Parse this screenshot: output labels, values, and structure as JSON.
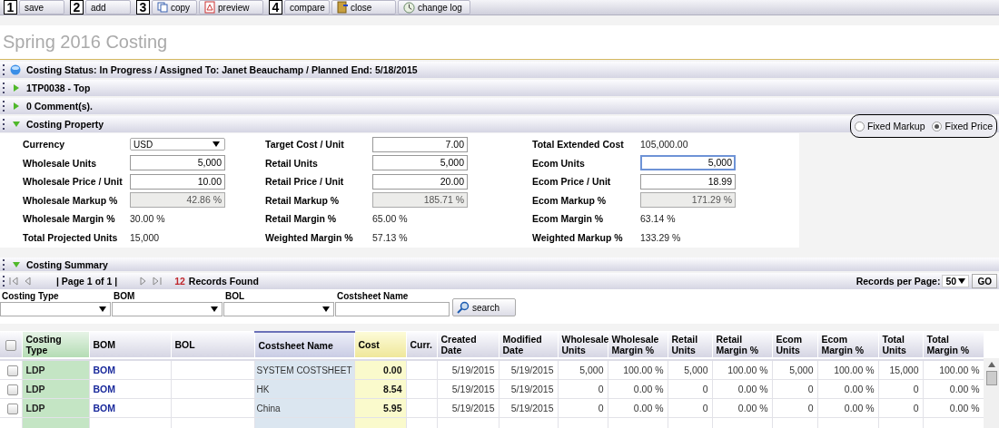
{
  "toolbar": [
    {
      "label": "save",
      "marker": "1"
    },
    {
      "label": "add",
      "marker": "2"
    },
    {
      "label": "copy",
      "marker": "3"
    },
    {
      "label": "preview"
    },
    {
      "label": "compare",
      "marker": "4"
    },
    {
      "label": "close"
    },
    {
      "label": "change log"
    }
  ],
  "title": "Spring 2016 Costing",
  "panels": [
    {
      "kind": "status",
      "title": "Costing  Status: In Progress / Assigned To: Janet Beauchamp / Planned End: 5/18/2015"
    },
    {
      "kind": "toggle",
      "title": "1TP0038 - Top",
      "expanded": false
    },
    {
      "kind": "toggle",
      "title": "0 Comment(s).",
      "expanded": false
    },
    {
      "kind": "toggle",
      "title": "Costing Property",
      "expanded": true
    }
  ],
  "pricing_mode": [
    {
      "label": "Fixed Markup",
      "selected": false
    },
    {
      "label": "Fixed Price",
      "selected": true
    }
  ],
  "form": [
    {
      "label": "Currency",
      "kind": "select",
      "value": "USD"
    },
    {
      "label": "Target Cost / Unit",
      "kind": "input",
      "value": "7.00",
      "focused": false
    },
    {
      "label": "Total Extended Cost",
      "kind": "text",
      "value": "105,000.00"
    },
    {
      "label": "Wholesale Units",
      "kind": "input",
      "value": "5,000",
      "focused": false
    },
    {
      "label": "Retail Units",
      "kind": "input",
      "value": "5,000",
      "focused": false
    },
    {
      "label": "Ecom Units",
      "kind": "input",
      "value": "5,000",
      "focused": true
    },
    {
      "label": "Wholesale Price / Unit",
      "kind": "input",
      "value": "10.00",
      "focused": false
    },
    {
      "label": "Retail Price / Unit",
      "kind": "input",
      "value": "20.00",
      "focused": false
    },
    {
      "label": "Ecom Price / Unit",
      "kind": "input",
      "value": "18.99",
      "focused": false
    },
    {
      "label": "Wholesale Markup %",
      "kind": "readonly",
      "value": "42.86 %"
    },
    {
      "label": "Retail Markup %",
      "kind": "readonly",
      "value": "185.71 %"
    },
    {
      "label": "Ecom Markup %",
      "kind": "readonly",
      "value": "171.29 %"
    },
    {
      "label": "Wholesale Margin %",
      "kind": "text",
      "value": "30.00 %"
    },
    {
      "label": "Retail Margin %",
      "kind": "text",
      "value": "65.00 %"
    },
    {
      "label": "Ecom Margin %",
      "kind": "text",
      "value": "63.14 %"
    },
    {
      "label": "Total Projected Units",
      "kind": "text",
      "value": "15,000"
    },
    {
      "label": "Weighted Margin %",
      "kind": "text",
      "value": "57.13 %"
    },
    {
      "label": "Weighted Markup %",
      "kind": "text",
      "value": "133.29 %"
    }
  ],
  "summary": {
    "title": "Costing Summary",
    "expanded": true,
    "pager": {
      "page": "| Page 1 of 1 |",
      "count": "12",
      "count_label": "Records Found",
      "per_page_label": "Records per Page:",
      "per_page": "50",
      "go": "GO"
    },
    "filters": [
      {
        "label": "Costing Type",
        "kind": "select"
      },
      {
        "label": "BOM",
        "kind": "select"
      },
      {
        "label": "BOL",
        "kind": "select"
      },
      {
        "label": "Costsheet Name",
        "kind": "input"
      }
    ],
    "search_button": "search",
    "table": {
      "select_all": false,
      "columns": [
        {
          "label": "Costing Type",
          "kind": "type"
        },
        {
          "label": "BOM",
          "kind": "link"
        },
        {
          "label": "BOL",
          "kind": "plain"
        },
        {
          "label": "Costsheet Name",
          "kind": "name"
        },
        {
          "label": "Cost",
          "kind": "cost"
        },
        {
          "label": "Curr.",
          "kind": "plain"
        },
        {
          "label": "Created Date",
          "kind": "num"
        },
        {
          "label": "Modified Date",
          "kind": "num"
        },
        {
          "label": "Wholesale Units",
          "kind": "num"
        },
        {
          "label": "Wholesale Margin %",
          "kind": "num"
        },
        {
          "label": "Retail Units",
          "kind": "num"
        },
        {
          "label": "Retail Margin %",
          "kind": "num"
        },
        {
          "label": "Ecom Units",
          "kind": "num"
        },
        {
          "label": "Ecom Margin %",
          "kind": "num"
        },
        {
          "label": "Total Units",
          "kind": "num"
        },
        {
          "label": "Total Margin %",
          "kind": "num"
        }
      ],
      "rows": [
        {
          "checked": false,
          "cells": [
            "LDP",
            "BOM",
            "",
            "SYSTEM COSTSHEET",
            "0.00",
            "",
            "5/19/2015",
            "5/19/2015",
            "5,000",
            "100.00 %",
            "5,000",
            "100.00 %",
            "5,000",
            "100.00 %",
            "15,000",
            "100.00 %"
          ]
        },
        {
          "checked": false,
          "cells": [
            "LDP",
            "BOM",
            "",
            "HK",
            "8.54",
            "",
            "5/19/2015",
            "5/19/2015",
            "0",
            "0.00 %",
            "0",
            "0.00 %",
            "0",
            "0.00 %",
            "0",
            "0.00 %"
          ]
        },
        {
          "checked": false,
          "cells": [
            "LDP",
            "BOM",
            "",
            "China",
            "5.95",
            "",
            "5/19/2015",
            "5/19/2015",
            "0",
            "0.00 %",
            "0",
            "0.00 %",
            "0",
            "0.00 %",
            "0",
            "0.00 %"
          ]
        }
      ]
    }
  }
}
